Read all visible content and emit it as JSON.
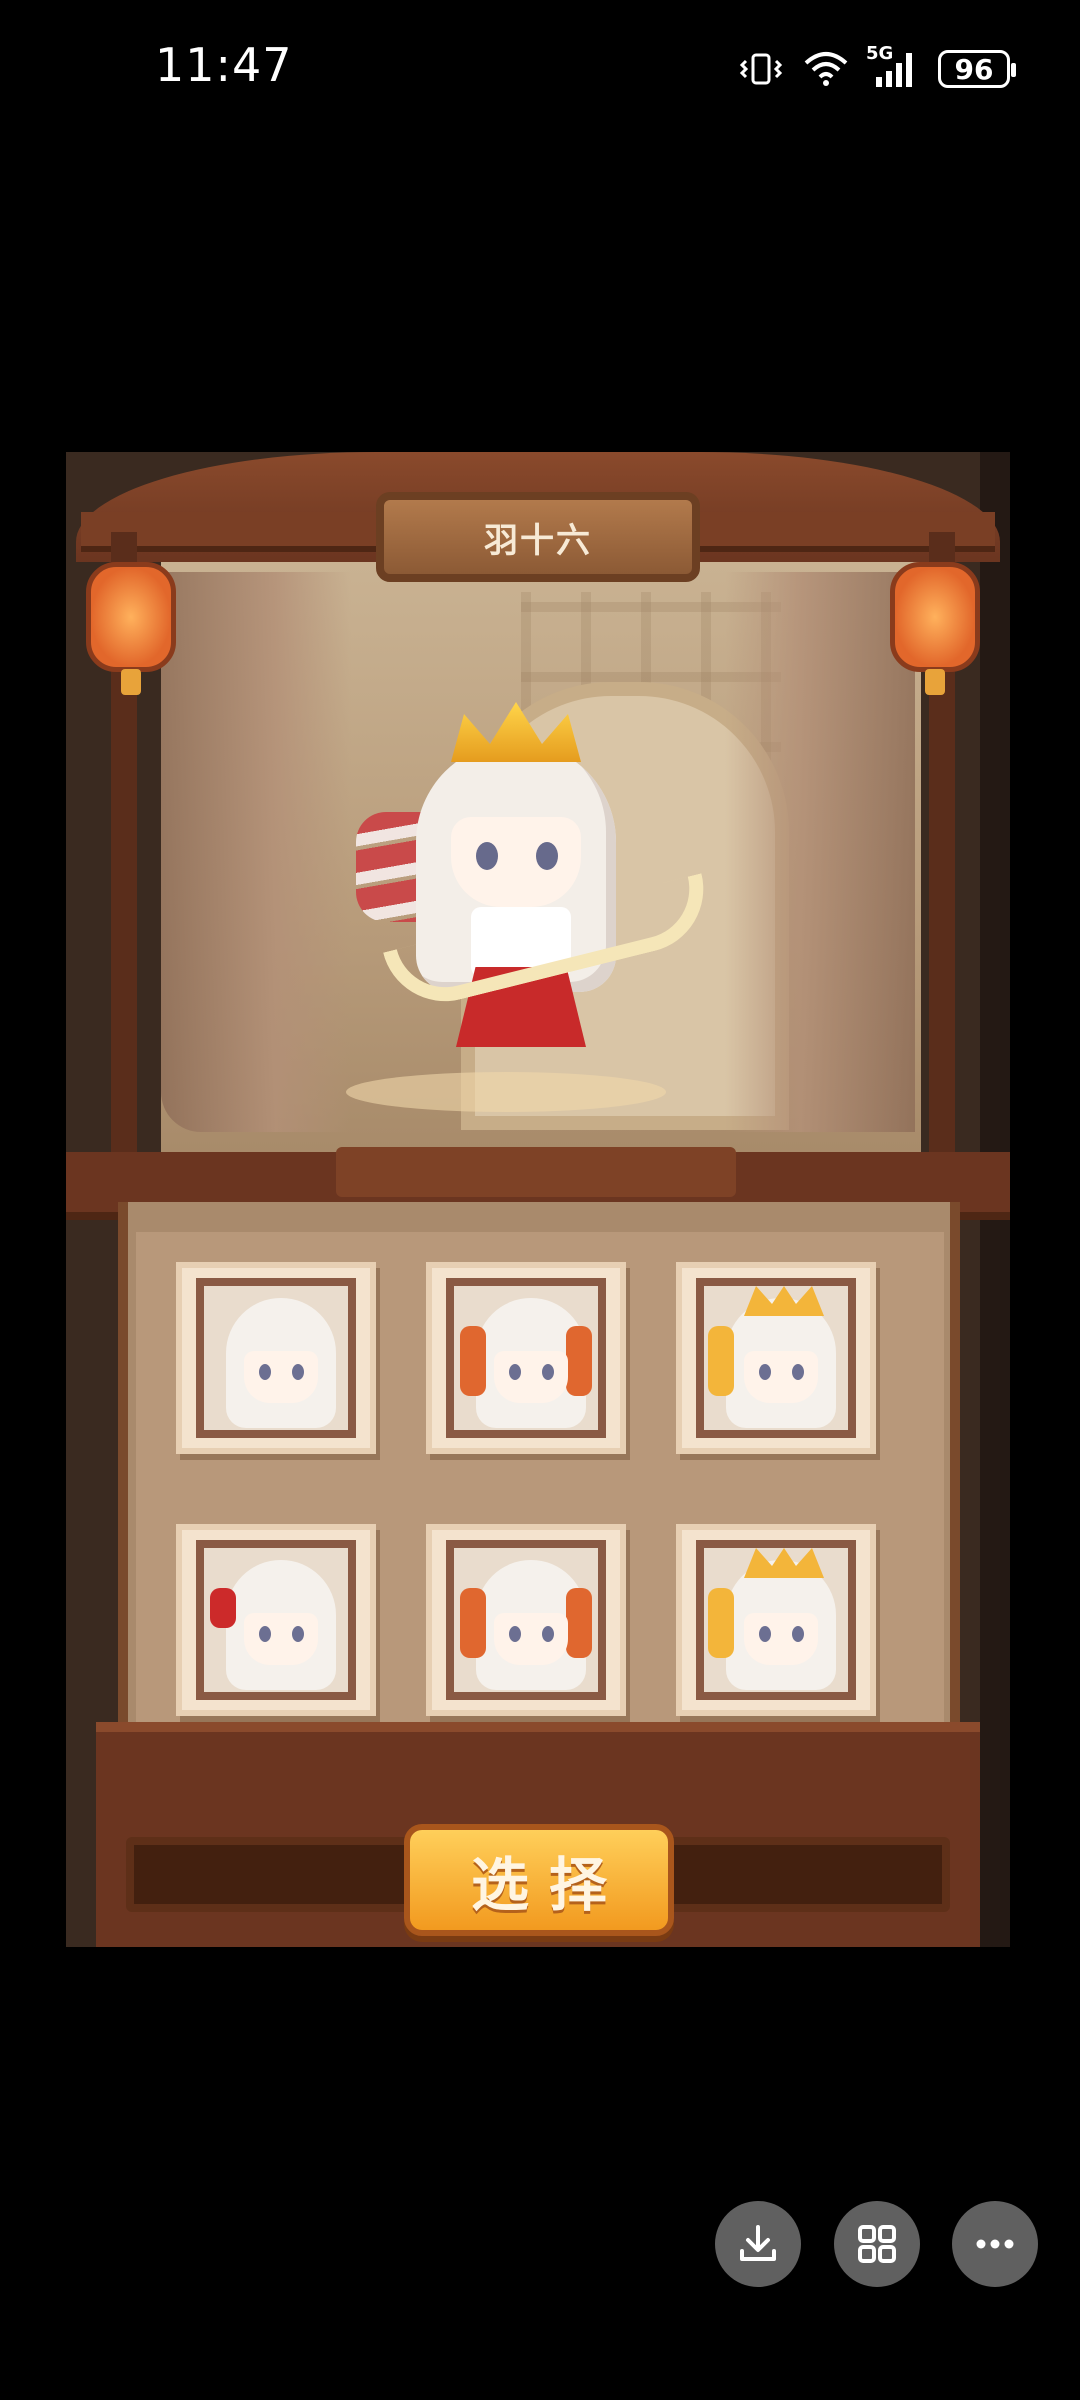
{
  "status_bar": {
    "time": "11:47",
    "network": "5G",
    "battery": "96"
  },
  "game": {
    "character_name": "羽十六",
    "select_label": "选择",
    "skins_count": 6
  },
  "floating_actions": {
    "download": "download-icon",
    "grid": "grid-icon",
    "more": "more-icon"
  }
}
